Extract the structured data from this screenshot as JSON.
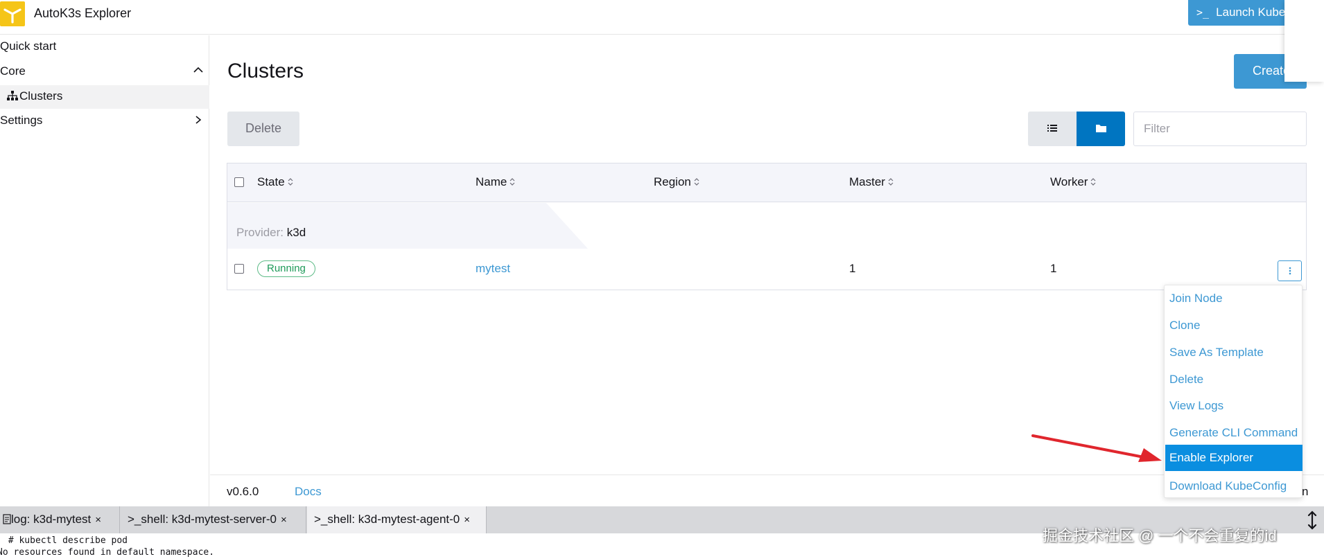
{
  "header": {
    "app_title": "AutoK3s Explorer",
    "launch_button": "Launch Kube",
    "launch_prompt": ">_"
  },
  "sidebar": {
    "items": [
      {
        "label": "Quick start"
      },
      {
        "label": "Core"
      },
      {
        "label": "Clusters"
      },
      {
        "label": "Settings"
      }
    ]
  },
  "main": {
    "title": "Clusters",
    "create_button": "Create",
    "delete_button": "Delete",
    "filter_placeholder": "Filter",
    "columns": [
      "State",
      "Name",
      "Region",
      "Master",
      "Worker"
    ],
    "group": {
      "key": "Provider:",
      "value": "k3d"
    },
    "rows": [
      {
        "state": "Running",
        "name": "mytest",
        "region": "",
        "master": "1",
        "worker": "1"
      }
    ]
  },
  "menu": {
    "items": [
      "Join Node",
      "Clone",
      "Save As Template",
      "Delete",
      "View Logs",
      "Generate CLI Command",
      "Enable Explorer",
      "Download KubeConfig"
    ],
    "highlighted": "Enable Explorer"
  },
  "footer": {
    "version": "v0.6.0",
    "docs": "Docs",
    "tail": "n"
  },
  "terminal": {
    "tabs": [
      {
        "label": "log: k3d-mytest",
        "icon": "document-icon"
      },
      {
        "label": ">_shell: k3d-mytest-server-0"
      },
      {
        "label": ">_shell: k3d-mytest-agent-0"
      }
    ],
    "close_glyph": "×",
    "lines": [
      " # kubectl describe pod",
      "No resources found in default namespace."
    ]
  },
  "watermark": "掘金技术社区 @ 一个不会重复的id",
  "colors": {
    "primary": "#3d98d3",
    "primary_dark": "#0075c1",
    "highlight": "#0a8ee0",
    "success": "#1e9a59",
    "arrow": "#e0262d",
    "logo": "#f5c518"
  }
}
